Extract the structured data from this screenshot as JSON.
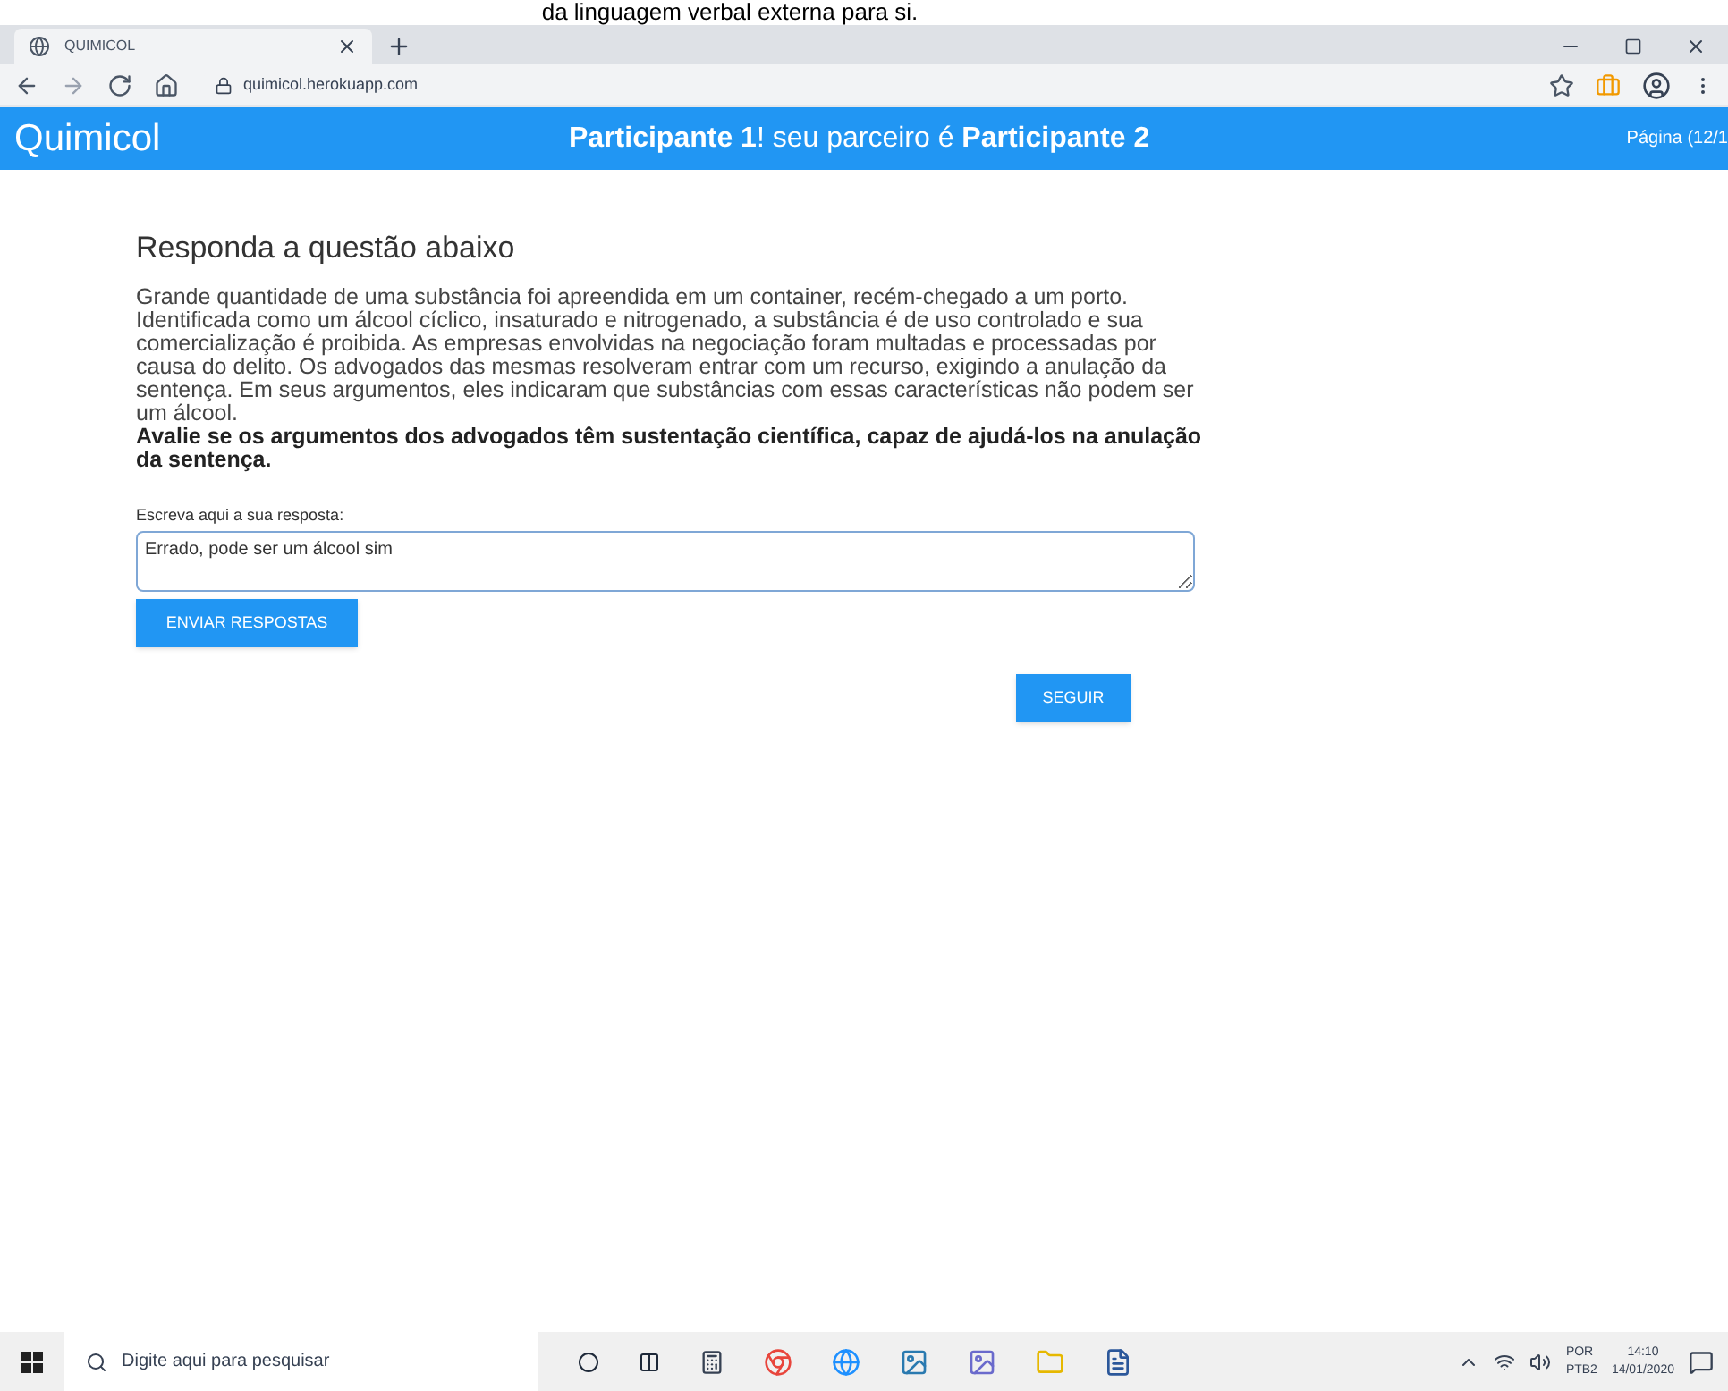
{
  "overlay_text": "da linguagem verbal externa para si.",
  "browser": {
    "tabs": [
      {
        "title": "QUIMICOL",
        "selected": true
      }
    ],
    "url": "quimicol.herokuapp.com"
  },
  "navbar": {
    "brand": "Quimicol",
    "message": "**Participante 1**! seu parceiro é **Participante 2**",
    "page": "Página (12/1"
  },
  "question": {
    "heading": "Responda a questão abaixo",
    "text": "Grande quantidade de uma substância foi apreendida em um container, recém-chegado a um porto. Identificada como um álcool cíclico, insaturado e nitrogenado, a substância é de uso controlado e sua comercialização é proibida. As empresas envolvidas na negociação foram multadas e processadas por causa do delito. Os advogados das mesmas resolveram entrar com um recurso, exigindo a anulação da sentença. Em seus argumentos, eles indicaram que substâncias com essas características não podem ser um álcool.",
    "prompt": "Avalie se os argumentos dos advogados têm sustentação científica, capaz de ajudá-los na anulação da sentença."
  },
  "answer": {
    "label": "Escreva aqui a sua resposta:",
    "value": "Errado, pode ser um álcool sim"
  },
  "buttons": {
    "submit": "ENVIAR RESPOSTAS",
    "next": "SEGUIR"
  },
  "taskbar": {
    "search_placeholder": "Digite aqui para pesquisar",
    "language": "POR",
    "layout": "PTB2",
    "time": "14:10",
    "date": "14/01/2020"
  }
}
